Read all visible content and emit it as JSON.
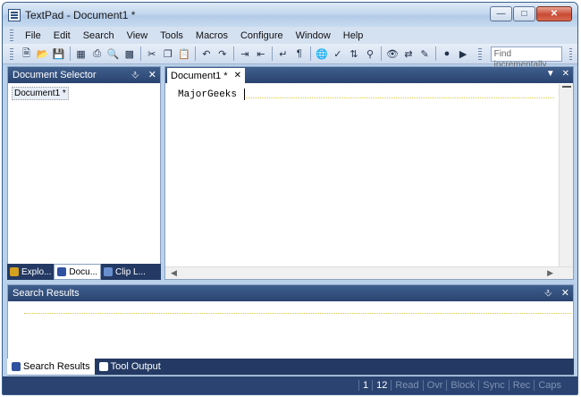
{
  "window": {
    "title": "TextPad - Document1 *"
  },
  "menu": [
    "File",
    "Edit",
    "Search",
    "View",
    "Tools",
    "Macros",
    "Configure",
    "Window",
    "Help"
  ],
  "toolbar": {
    "find_placeholder": "Find incrementally"
  },
  "document_selector": {
    "title": "Document Selector",
    "documents": [
      "Document1 *"
    ]
  },
  "left_tabs": [
    {
      "label": "Explo...",
      "icon": "explorer-icon",
      "color": "#d4a020"
    },
    {
      "label": "Docu...",
      "icon": "documents-icon",
      "color": "#3050a0"
    },
    {
      "label": "Clip L...",
      "icon": "clip-library-icon",
      "color": "#6a8fd0"
    }
  ],
  "editor": {
    "tab_label": "Document1 *",
    "text": "MajorGeeks"
  },
  "search_results": {
    "title": "Search Results"
  },
  "bottom_tabs": [
    {
      "label": "Search Results",
      "icon": "search-results-icon"
    },
    {
      "label": "Tool Output",
      "icon": "tool-output-icon"
    }
  ],
  "status": {
    "line": "1",
    "column": "12",
    "flags": [
      "Read",
      "Ovr",
      "Block",
      "Sync",
      "Rec",
      "Caps"
    ]
  }
}
